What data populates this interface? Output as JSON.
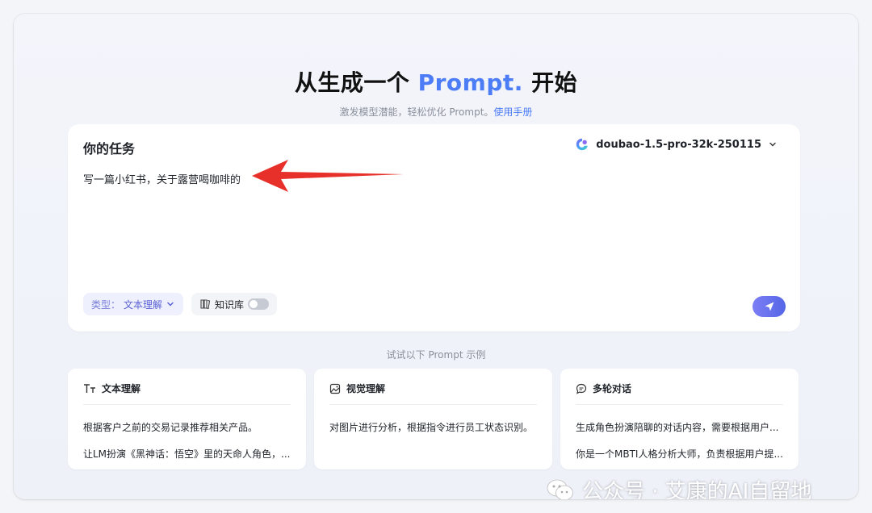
{
  "hero": {
    "title_part1": "从生成一个 ",
    "title_accent": "Prompt.",
    "title_part2": " 开始",
    "subtitle": "激发模型潜能，轻松优化 Prompt。",
    "manual_link": "使用手册"
  },
  "task": {
    "title": "你的任务",
    "model": "doubao-1.5-pro-32k-250115",
    "text": "写一篇小红书，关于露营喝咖啡的",
    "type_label": "类型：",
    "type_value": "文本理解",
    "knowledge_label": "知识库",
    "knowledge_enabled": false
  },
  "examples": {
    "heading": "试试以下 Prompt 示例",
    "cards": [
      {
        "icon": "text-size-icon",
        "title": "文本理解",
        "items": [
          "根据客户之前的交易记录推荐相关产品。",
          "让LM扮演《黑神话：悟空》里的天命人角色，..."
        ]
      },
      {
        "icon": "image-icon",
        "title": "视觉理解",
        "items": [
          "对图片进行分析，根据指令进行员工状态识别。"
        ]
      },
      {
        "icon": "chat-bubble-icon",
        "title": "多轮对话",
        "items": [
          "生成角色扮演陪聊的对话内容，需要根据用户...",
          "你是一个MBTI人格分析大师，负责根据用户提..."
        ]
      }
    ]
  },
  "watermark": "公众号 · 艾康的AI自留地",
  "colors": {
    "accent": "#4c7cf6",
    "arrow": "#e8302a",
    "type_pill_text": "#5b62d6",
    "send_button": "#6a70ee"
  }
}
